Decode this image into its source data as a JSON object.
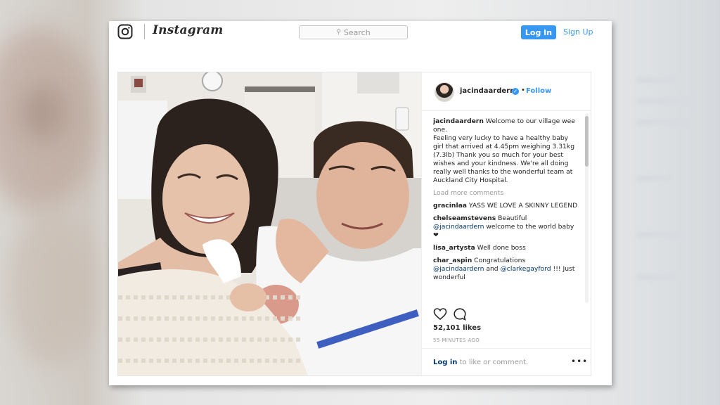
{
  "header": {
    "brand": "Instagram",
    "search_placeholder": "Search",
    "login_label": "Log In",
    "signup_label": "Sign Up"
  },
  "post": {
    "username": "jacindaardern",
    "dot": "•",
    "follow_label": "Follow",
    "comments": [
      {
        "user": "jacindaardern",
        "parts": [
          " Welcome to our village wee one.",
          " Feeling very lucky to have a healthy baby girl that arrived at 4.45pm weighing 3.31kg (7.3lb) Thank you so much for your best wishes and your kindness. We're all doing really well thanks to the wonderful team at Auckland City Hospital."
        ]
      },
      {
        "user": "gracinlaa",
        "text": " YASS WE LOVE A SKINNY LEGEND"
      },
      {
        "user": "chelseamstevens",
        "text": " Beautiful",
        "mention": "@jacindaardern",
        "after": " welcome to the world baby ❤"
      },
      {
        "user": "lisa_artysta",
        "text": " Well done boss"
      },
      {
        "user": "char_aspin",
        "text": " Congratulations",
        "mention": "@jacindaardern",
        "mid": " and ",
        "mention2": "@clarkegayford",
        "after": " !!! Just wonderful"
      }
    ],
    "load_more": "Load more comments",
    "likes": "52,101 likes",
    "time_ago": "55 MINUTES AGO",
    "login_link": "Log in",
    "login_suffix": " to like or comment.",
    "more": "•••"
  },
  "icons": {
    "logo": "instagram-logo-icon",
    "search": "search-icon",
    "verified": "verified-badge-icon",
    "like": "heart-icon",
    "comment": "comment-icon",
    "options": "more-options-icon"
  },
  "colors": {
    "accent": "#3897f0",
    "link_dark": "#003569",
    "muted": "#999999"
  }
}
